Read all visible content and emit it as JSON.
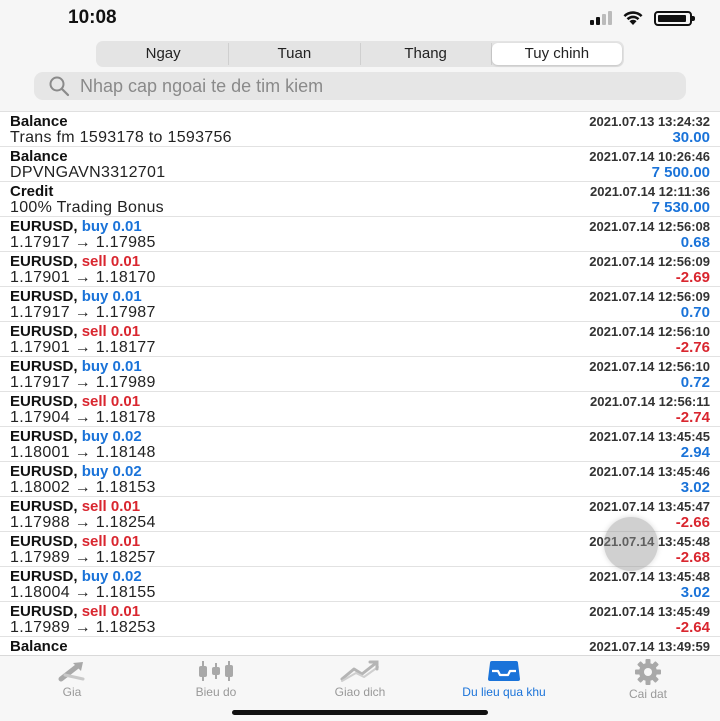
{
  "status": {
    "time": "10:08"
  },
  "segments": [
    {
      "label": "Ngay",
      "active": false
    },
    {
      "label": "Tuan",
      "active": false
    },
    {
      "label": "Thang",
      "active": false
    },
    {
      "label": "Tuy chinh",
      "active": true
    }
  ],
  "search": {
    "placeholder": "Nhap cap ngoai te de tim kiem"
  },
  "rows": [
    {
      "title": "Balance",
      "side": "",
      "detail": "Trans fm 1593178 to 1593756",
      "time": "2021.07.13 13:24:32",
      "amount": "30.00",
      "sign": "pos"
    },
    {
      "title": "Balance",
      "side": "",
      "detail": "DPVNGAVN3312701",
      "time": "2021.07.14 10:26:46",
      "amount": "7 500.00",
      "sign": "pos"
    },
    {
      "title": "Credit",
      "side": "",
      "detail": "100% Trading Bonus",
      "time": "2021.07.14 12:11:36",
      "amount": "7 530.00",
      "sign": "pos"
    },
    {
      "title": "EURUSD,",
      "side": "buy 0.01",
      "detail": "1.17917 → 1.17985",
      "time": "2021.07.14 12:56:08",
      "amount": "0.68",
      "sign": "pos"
    },
    {
      "title": "EURUSD,",
      "side": "sell 0.01",
      "detail": "1.17901 → 1.18170",
      "time": "2021.07.14 12:56:09",
      "amount": "-2.69",
      "sign": "neg"
    },
    {
      "title": "EURUSD,",
      "side": "buy 0.01",
      "detail": "1.17917 → 1.17987",
      "time": "2021.07.14 12:56:09",
      "amount": "0.70",
      "sign": "pos"
    },
    {
      "title": "EURUSD,",
      "side": "sell 0.01",
      "detail": "1.17901 → 1.18177",
      "time": "2021.07.14 12:56:10",
      "amount": "-2.76",
      "sign": "neg"
    },
    {
      "title": "EURUSD,",
      "side": "buy 0.01",
      "detail": "1.17917 → 1.17989",
      "time": "2021.07.14 12:56:10",
      "amount": "0.72",
      "sign": "pos"
    },
    {
      "title": "EURUSD,",
      "side": "sell 0.01",
      "detail": "1.17904 → 1.18178",
      "time": "2021.07.14 12:56:11",
      "amount": "-2.74",
      "sign": "neg"
    },
    {
      "title": "EURUSD,",
      "side": "buy 0.02",
      "detail": "1.18001 → 1.18148",
      "time": "2021.07.14 13:45:45",
      "amount": "2.94",
      "sign": "pos"
    },
    {
      "title": "EURUSD,",
      "side": "buy 0.02",
      "detail": "1.18002 → 1.18153",
      "time": "2021.07.14 13:45:46",
      "amount": "3.02",
      "sign": "pos"
    },
    {
      "title": "EURUSD,",
      "side": "sell 0.01",
      "detail": "1.17988 → 1.18254",
      "time": "2021.07.14 13:45:47",
      "amount": "-2.66",
      "sign": "neg"
    },
    {
      "title": "EURUSD,",
      "side": "sell 0.01",
      "detail": "1.17989 → 1.18257",
      "time": "2021.07.14 13:45:48",
      "amount": "-2.68",
      "sign": "neg"
    },
    {
      "title": "EURUSD,",
      "side": "buy 0.02",
      "detail": "1.18004 → 1.18155",
      "time": "2021.07.14 13:45:48",
      "amount": "3.02",
      "sign": "pos"
    },
    {
      "title": "EURUSD,",
      "side": "sell 0.01",
      "detail": "1.17989 → 1.18253",
      "time": "2021.07.14 13:45:49",
      "amount": "-2.64",
      "sign": "neg"
    },
    {
      "title": "Balance",
      "side": "",
      "detail": "",
      "time": "2021.07.14 13:49:59",
      "amount": "",
      "sign": "pos"
    }
  ],
  "tabs": [
    {
      "label": "Gia",
      "icon": "price-arrows-icon",
      "active": false
    },
    {
      "label": "Bieu do",
      "icon": "candlestick-chart-icon",
      "active": false
    },
    {
      "label": "Giao dich",
      "icon": "trade-chart-icon",
      "active": false
    },
    {
      "label": "Du lieu qua khu",
      "icon": "history-inbox-icon",
      "active": true
    },
    {
      "label": "Cai dat",
      "icon": "gear-icon",
      "active": false
    }
  ],
  "colors": {
    "accent": "#1a73d9",
    "negative": "#d9262f"
  }
}
